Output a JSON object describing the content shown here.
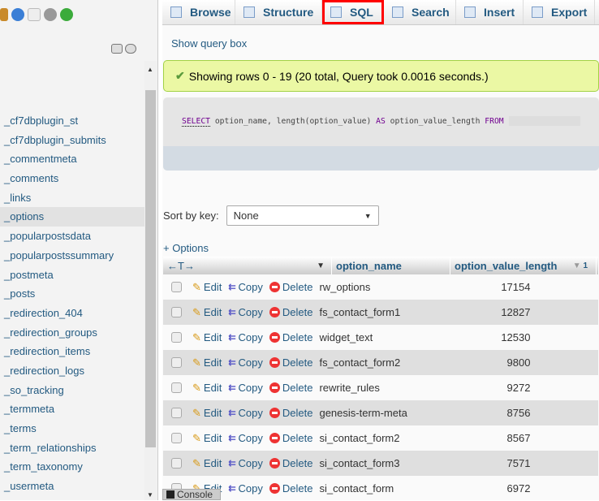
{
  "sidebar": {
    "tables": [
      "_cf7dbplugin_st",
      "_cf7dbplugin_submits",
      "_commentmeta",
      "_comments",
      "_links",
      "_options",
      "_popularpostsdata",
      "_popularpostssummary",
      "_postmeta",
      "_posts",
      "_redirection_404",
      "_redirection_groups",
      "_redirection_items",
      "_redirection_logs",
      "_so_tracking",
      "_termmeta",
      "_terms",
      "_term_relationships",
      "_term_taxonomy",
      "_usermeta"
    ],
    "selected": "_options"
  },
  "tabs": [
    {
      "label": "Browse",
      "icon": "browse-icon"
    },
    {
      "label": "Structure",
      "icon": "structure-icon"
    },
    {
      "label": "SQL",
      "icon": "sql-icon",
      "active": true
    },
    {
      "label": "Search",
      "icon": "search-icon"
    },
    {
      "label": "Insert",
      "icon": "insert-icon"
    },
    {
      "label": "Export",
      "icon": "export-icon"
    }
  ],
  "show_query_box": "Show query box",
  "message": "Showing rows 0 - 19 (20 total, Query took 0.0016 seconds.)",
  "sql": {
    "select": "SELECT",
    "part1": " option_name, length(option_value) ",
    "as": "AS",
    "part2": " option_value_length ",
    "from": "FROM"
  },
  "sort": {
    "label": "Sort by key:",
    "value": "None"
  },
  "options_link": "+ Options",
  "columns": {
    "name": "option_name",
    "length": "option_value_length",
    "sort_index": "1"
  },
  "actions": {
    "edit": "Edit",
    "copy": "Copy",
    "delete": "Delete"
  },
  "rows": [
    {
      "name": "rw_options",
      "len": "17154"
    },
    {
      "name": "fs_contact_form1",
      "len": "12827"
    },
    {
      "name": "widget_text",
      "len": "12530"
    },
    {
      "name": "fs_contact_form2",
      "len": "9800"
    },
    {
      "name": "rewrite_rules",
      "len": "9272"
    },
    {
      "name": "genesis-term-meta",
      "len": "8756"
    },
    {
      "name": "si_contact_form2",
      "len": "8567"
    },
    {
      "name": "si_contact_form3",
      "len": "7571"
    },
    {
      "name": "si_contact_form",
      "len": "6972"
    }
  ],
  "console": "Console"
}
